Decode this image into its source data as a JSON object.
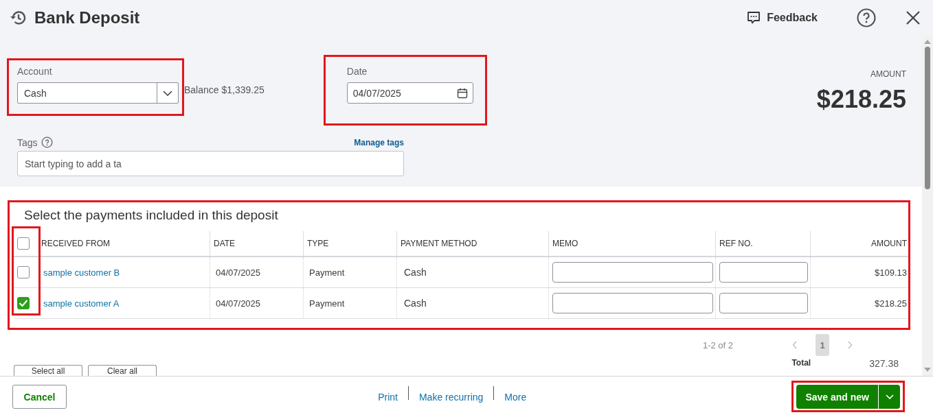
{
  "header": {
    "title": "Bank Deposit",
    "feedback": "Feedback"
  },
  "account": {
    "label": "Account",
    "value": "Cash",
    "balance": "Balance $1,339.25",
    "highlighted": true
  },
  "date": {
    "label": "Date",
    "value": "04/07/2025",
    "highlighted": true
  },
  "amount": {
    "label": "AMOUNT",
    "value": "$218.25"
  },
  "tags": {
    "label": "Tags",
    "manage_link": "Manage tags",
    "placeholder": "Start typing to add a ta"
  },
  "payments": {
    "title": "Select the payments included in this deposit",
    "highlighted": true,
    "checkbox_column_highlighted": true,
    "select_all_checked": false,
    "columns": [
      "RECEIVED FROM",
      "DATE",
      "TYPE",
      "PAYMENT METHOD",
      "MEMO",
      "REF NO.",
      "AMOUNT"
    ],
    "rows": [
      {
        "received_from": "sample customer B",
        "date": "04/07/2025",
        "type": "Payment",
        "payment_method": "Cash",
        "amount": "$109.13",
        "selected": false
      },
      {
        "received_from": "sample customer A",
        "date": "04/07/2025",
        "type": "Payment",
        "payment_method": "Cash",
        "amount": "$218.25",
        "selected": true
      }
    ],
    "pagination": {
      "range": "1-2 of 2",
      "pages": [
        {
          "label": "1",
          "selected": true
        }
      ]
    },
    "total_label": "Total",
    "total": "327.38",
    "buttons": [
      "Select all",
      "Clear all"
    ]
  },
  "footer": {
    "cancel": "Cancel",
    "links": [
      "Print",
      "Make recurring",
      "More"
    ],
    "save": {
      "label": "Save and new",
      "highlighted": true
    }
  }
}
